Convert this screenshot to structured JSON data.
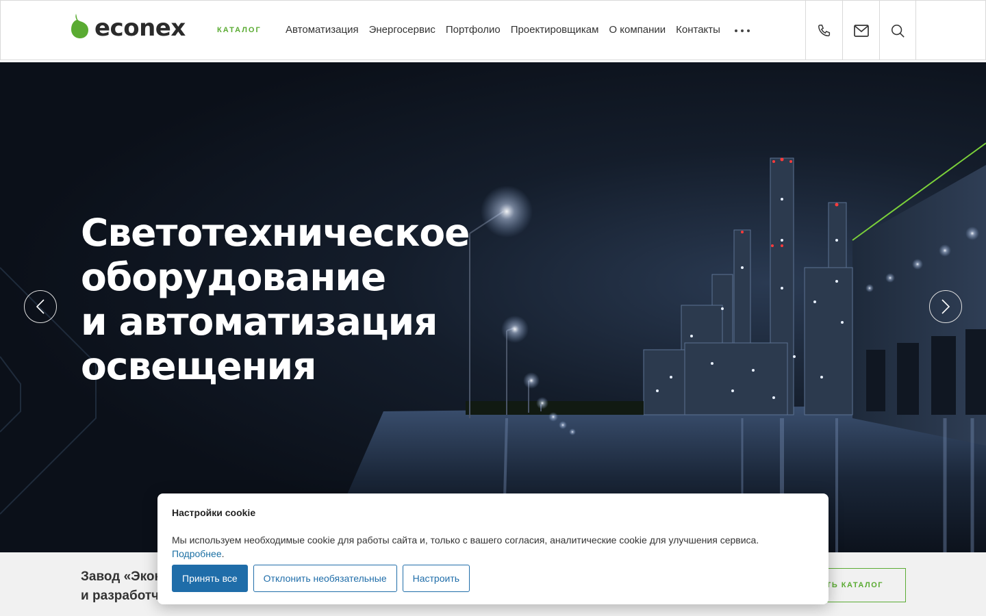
{
  "header": {
    "logo_text": "econex",
    "catalog_label": "КАТАЛОГ",
    "nav": [
      "Автоматизация",
      "Энергосервис",
      "Портфолио",
      "Проектировщикам",
      "О компании",
      "Контакты"
    ],
    "icons": [
      "more-icon",
      "phone-icon",
      "mail-icon",
      "search-icon"
    ]
  },
  "hero": {
    "title_lines": [
      "Светотехническое",
      "оборудование",
      "и автоматизация",
      "освещения"
    ]
  },
  "strip": {
    "text_line1": "Завод «Экон",
    "text_line2": "и разработч",
    "button_label": "ТЬ КАТАЛОГ"
  },
  "cookie": {
    "title": "Настройки cookie",
    "text": "Мы используем необходимые cookie для работы сайта и, только с вашего согласия, аналитические cookie для улучшения сервиса.",
    "more_link": "Подробнее",
    "period": ".",
    "accept_all": "Принять все",
    "decline_optional": "Отклонить необязательные",
    "configure": "Настроить"
  },
  "colors": {
    "brand_green": "#5aab32",
    "accept_blue": "#1f6da9",
    "link_blue": "#1a6fa3"
  }
}
